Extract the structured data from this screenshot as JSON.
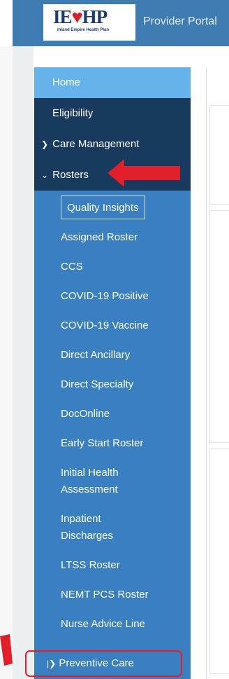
{
  "header": {
    "logo_text_left": "IE",
    "logo_text_right": "HP",
    "logo_tagline": "Inland Empire Health Plan",
    "portal_title": "Provider Portal"
  },
  "sidebar": {
    "top_items": [
      {
        "label": "Home",
        "state": "active"
      },
      {
        "label": "Eligibility"
      },
      {
        "label": "Care Management",
        "icon": "chevron-right-icon"
      },
      {
        "label": "Rosters",
        "icon": "chevron-down-icon",
        "expanded": true
      }
    ],
    "rosters_submenu": [
      "Quality Insights",
      "Assigned Roster",
      "CCS",
      "COVID-19 Positive",
      "COVID-19 Vaccine",
      "Direct Ancillary",
      "Direct Specialty",
      "DocOnline",
      "Early Start Roster",
      "Initial Health Assessment",
      "Inpatient Discharges",
      "LTSS Roster",
      "NEMT PCS Roster",
      "Nurse Advice Line"
    ],
    "preventive_care": "Preventive Care"
  },
  "colors": {
    "sidebar_blue": "#3a7fc1",
    "active_item": "#65b3ea",
    "dark_item": "#173a5e",
    "header_blue": "#3e7cb1",
    "annotation_red": "#e01f2a"
  }
}
